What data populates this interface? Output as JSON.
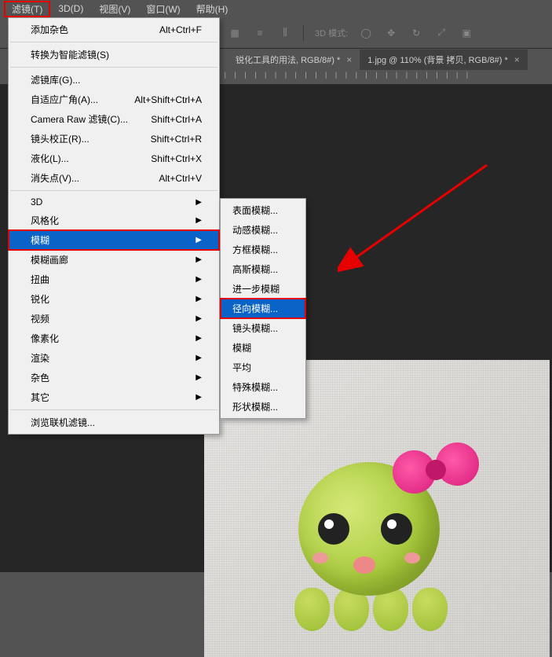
{
  "menubar": {
    "items": [
      {
        "label": "滤镜(T)",
        "highlighted": true
      },
      {
        "label": "3D(D)"
      },
      {
        "label": "视图(V)"
      },
      {
        "label": "窗口(W)"
      },
      {
        "label": "帮助(H)"
      }
    ]
  },
  "toolbar": {
    "mode_label": "3D 模式:"
  },
  "tabs": {
    "items": [
      {
        "label": "锐化工具的用法, RGB/8#) *",
        "active": false
      },
      {
        "label": "1.jpg @ 110% (背景 拷贝, RGB/8#) *",
        "active": true
      }
    ]
  },
  "filter_menu": {
    "items": [
      {
        "label": "添加杂色",
        "shortcut": "Alt+Ctrl+F",
        "type": "item"
      },
      {
        "type": "sep"
      },
      {
        "label": "转换为智能滤镜(S)",
        "type": "item"
      },
      {
        "type": "sep"
      },
      {
        "label": "滤镜库(G)...",
        "type": "item"
      },
      {
        "label": "自适应广角(A)...",
        "shortcut": "Alt+Shift+Ctrl+A",
        "type": "item"
      },
      {
        "label": "Camera Raw 滤镜(C)...",
        "shortcut": "Shift+Ctrl+A",
        "type": "item"
      },
      {
        "label": "镜头校正(R)...",
        "shortcut": "Shift+Ctrl+R",
        "type": "item"
      },
      {
        "label": "液化(L)...",
        "shortcut": "Shift+Ctrl+X",
        "type": "item"
      },
      {
        "label": "消失点(V)...",
        "shortcut": "Alt+Ctrl+V",
        "type": "item"
      },
      {
        "type": "sep"
      },
      {
        "label": "3D",
        "submenu": true,
        "type": "item"
      },
      {
        "label": "风格化",
        "submenu": true,
        "type": "item"
      },
      {
        "label": "模糊",
        "submenu": true,
        "hovered": true,
        "boxed": true,
        "type": "item"
      },
      {
        "label": "模糊画廊",
        "submenu": true,
        "type": "item"
      },
      {
        "label": "扭曲",
        "submenu": true,
        "type": "item"
      },
      {
        "label": "锐化",
        "submenu": true,
        "type": "item"
      },
      {
        "label": "视频",
        "submenu": true,
        "type": "item"
      },
      {
        "label": "像素化",
        "submenu": true,
        "type": "item"
      },
      {
        "label": "渲染",
        "submenu": true,
        "type": "item"
      },
      {
        "label": "杂色",
        "submenu": true,
        "type": "item"
      },
      {
        "label": "其它",
        "submenu": true,
        "type": "item"
      },
      {
        "type": "sep"
      },
      {
        "label": "浏览联机滤镜...",
        "type": "item"
      }
    ]
  },
  "blur_submenu": {
    "items": [
      {
        "label": "表面模糊..."
      },
      {
        "label": "动感模糊..."
      },
      {
        "label": "方框模糊..."
      },
      {
        "label": "高斯模糊..."
      },
      {
        "label": "进一步模糊"
      },
      {
        "label": "径向模糊...",
        "hovered": true,
        "boxed": true
      },
      {
        "label": "镜头模糊..."
      },
      {
        "label": "模糊"
      },
      {
        "label": "平均"
      },
      {
        "label": "特殊模糊..."
      },
      {
        "label": "形状模糊..."
      }
    ]
  }
}
